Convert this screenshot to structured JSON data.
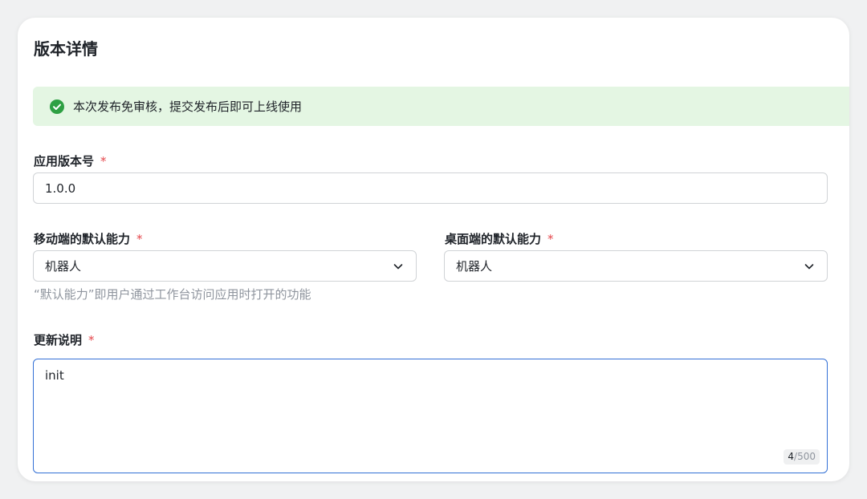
{
  "page_title": "版本详情",
  "alert": {
    "icon": "check-circle-icon",
    "text": "本次发布免审核，提交发布后即可上线使用",
    "color": "#2ea043"
  },
  "version_field": {
    "label": "应用版本号",
    "required_mark": "*",
    "value": "1.0.0"
  },
  "mobile_ability": {
    "label": "移动端的默认能力",
    "required_mark": "*",
    "value": "机器人",
    "icon": "chevron-down-icon"
  },
  "desktop_ability": {
    "label": "桌面端的默认能力",
    "required_mark": "*",
    "value": "机器人",
    "icon": "chevron-down-icon"
  },
  "ability_helper": "“默认能力”即用户通过工作台访问应用时打开的功能",
  "release_notes": {
    "label": "更新说明",
    "required_mark": "*",
    "value": "init",
    "count_current": "4",
    "count_max": "/500"
  },
  "colors": {
    "accent": "#3370d6",
    "required": "#e5484d",
    "alert_bg": "#e4f6e3"
  }
}
